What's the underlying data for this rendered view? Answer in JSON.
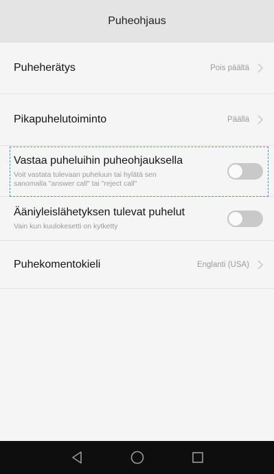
{
  "header": {
    "title": "Puheohjaus"
  },
  "settings": [
    {
      "title": "Puheherätys",
      "value": "Pois päältä"
    },
    {
      "title": "Pikapuhelutoiminto",
      "value": "Päällä"
    },
    {
      "title": "Vastaa puheluihin puheohjauksella",
      "subtitle_line1": "Voit vastata tulevaan puheluun tai hylätä sen",
      "subtitle_line2": "sanomalla \"answer call\" tai \"reject call\"",
      "toggle_on": false
    },
    {
      "title": "Ääniyleislähetyksen tulevat puhelut",
      "subtitle_line1": "Vain kun kuulokesetti on kytketty",
      "toggle_on": false
    },
    {
      "title": "Puhekomentokieli",
      "value": "Englanti (USA)"
    }
  ],
  "colors": {
    "highlight": "#2aa2b8",
    "toggle_off": "#c9c9c9",
    "navbar": "#0e0e0e"
  },
  "navbar": {
    "icons": [
      "back-icon",
      "home-icon",
      "recents-icon"
    ]
  }
}
